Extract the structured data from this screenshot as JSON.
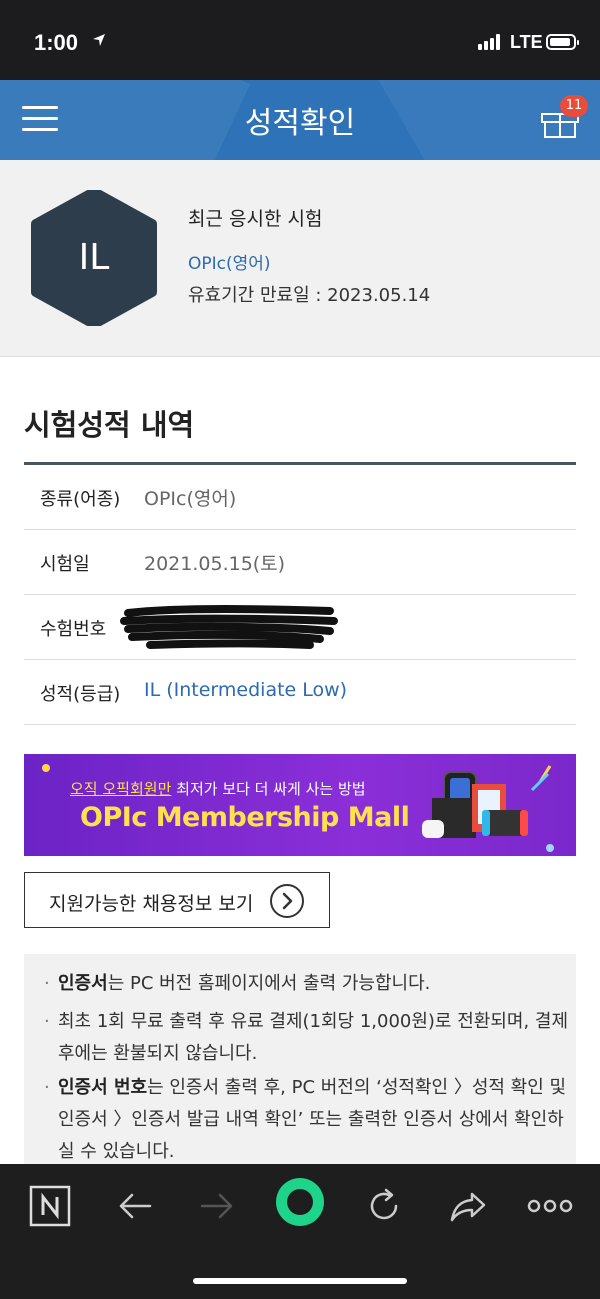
{
  "status_bar": {
    "time": "1:00",
    "network": "LTE"
  },
  "header": {
    "title": "성적확인",
    "badge_count": "11"
  },
  "profile": {
    "avatar_initials": "IL",
    "recent_title": "최근 응시한 시험",
    "recent_exam": "OPIc(영어)",
    "expiry": "유효기간 만료일 : 2023.05.14"
  },
  "results": {
    "section_title": "시험성적 내역",
    "rows": [
      {
        "label": "종류(어종)",
        "value": "OPIc(영어)"
      },
      {
        "label": "시험일",
        "value": "2021.05.15(토)"
      },
      {
        "label": "수험번호",
        "value": ""
      },
      {
        "label": "성적(등급)",
        "value": "IL (Intermediate Low)"
      }
    ]
  },
  "banner": {
    "sub_highlight": "오직 오픽회원만",
    "sub_rest": " 최저가 보다 더 싸게 사는 방법",
    "title": "OPIc Membership Mall"
  },
  "jobs_button": {
    "label": "지원가능한 채용정보 보기"
  },
  "notice": {
    "items": [
      {
        "bold": "인증서",
        "text": "는 PC 버전 홈페이지에서 출력 가능합니다."
      },
      {
        "bold": "",
        "text": "최초 1회 무료 출력 후 유료 결제(1회당 1,000원)로 전환되며, 결제 후에는 환불되지 않습니다."
      },
      {
        "bold": "인증서 번호",
        "text": "는 인증서 출력 후, PC 버전의 ‘성적확인 〉성적 확인 및 인증서 〉인증서 발급 내역 확인’ 또는 출력한 인증서 상에서 확인하실 수 있습니다."
      }
    ]
  },
  "colors": {
    "header": "#2e73b8",
    "link": "#2e6ab0",
    "banner": "#7a28cc",
    "accent_green": "#1ed38a"
  }
}
